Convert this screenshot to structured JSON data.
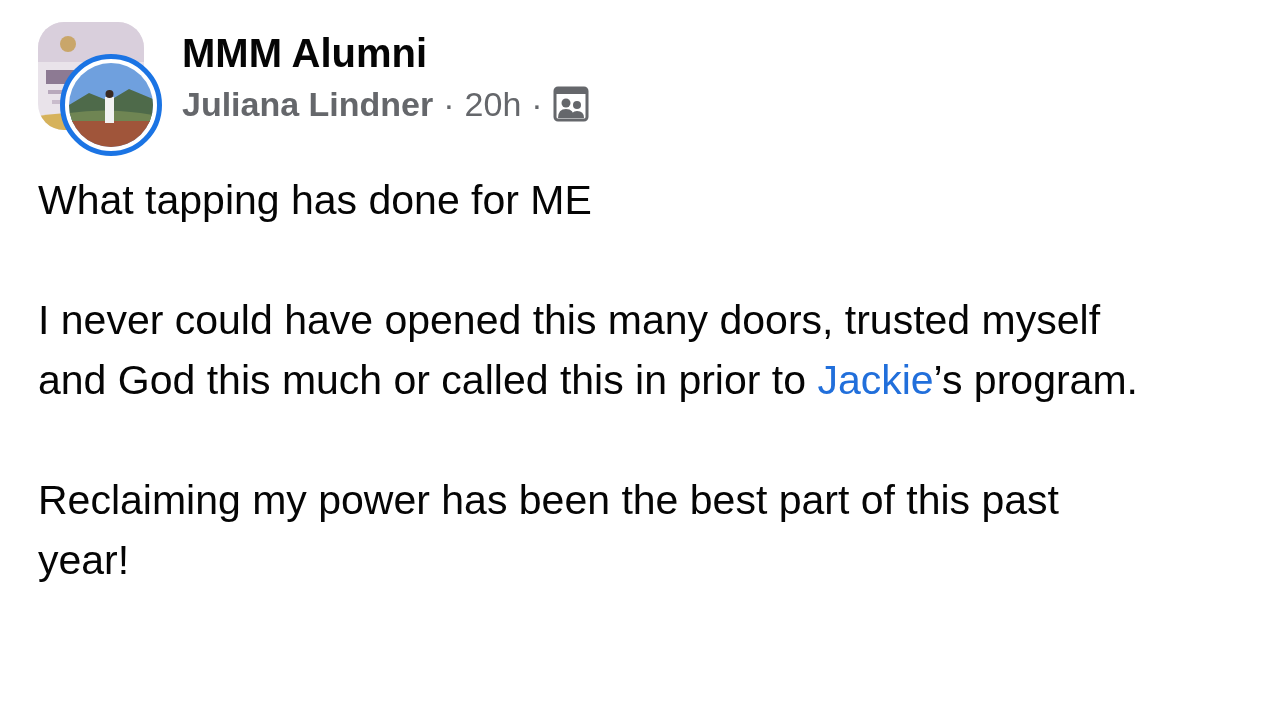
{
  "header": {
    "group_name": "MMM Alumni",
    "author": "Juliana Lindner",
    "separator_1": "·",
    "time": "20h",
    "separator_2": "·"
  },
  "post": {
    "paragraphs": [
      [
        {
          "kind": "text",
          "text": "What tapping has done for ME"
        }
      ],
      [
        {
          "kind": "text",
          "text": "I never could have opened this many doors, trusted myself and God this much or called this in prior to "
        },
        {
          "kind": "mention",
          "text": "Jackie"
        },
        {
          "kind": "text",
          "text": "’s program."
        }
      ],
      [
        {
          "kind": "text",
          "text": "Reclaiming my power has been the best part of this past year!"
        }
      ]
    ]
  }
}
